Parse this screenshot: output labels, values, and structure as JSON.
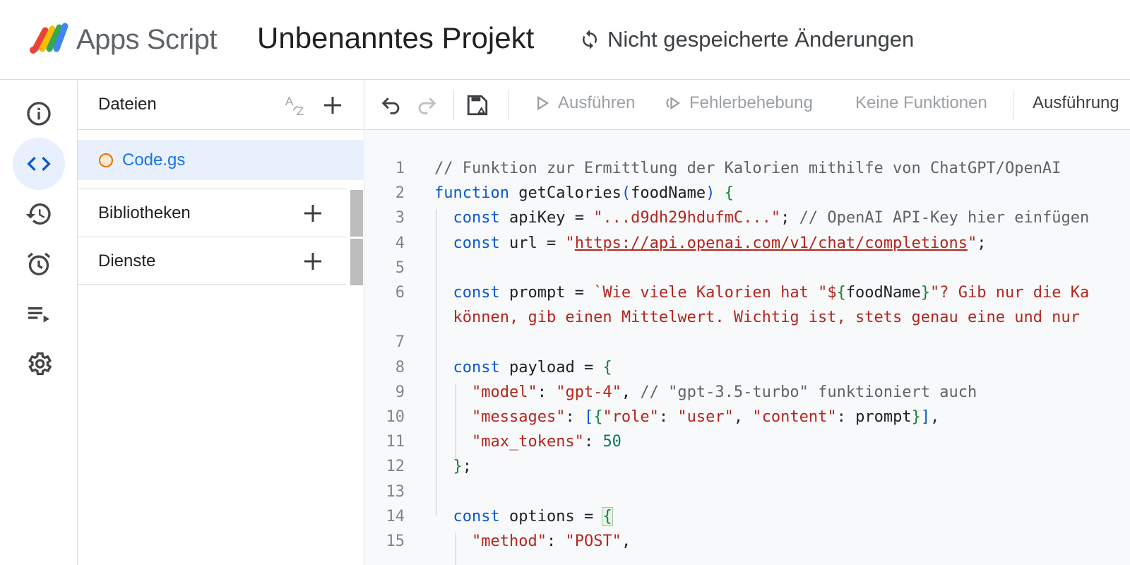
{
  "header": {
    "product_name": "Apps Script",
    "project_title": "Unbenanntes Projekt",
    "save_status": "Nicht gespeicherte Änderungen"
  },
  "rail": {
    "items": [
      {
        "name": "overview",
        "icon": "info-icon",
        "active": false
      },
      {
        "name": "editor",
        "icon": "code-icon",
        "active": true
      },
      {
        "name": "executions",
        "icon": "history-icon",
        "active": false
      },
      {
        "name": "triggers",
        "icon": "alarm-icon",
        "active": false
      },
      {
        "name": "executions-log",
        "icon": "playlist-icon",
        "active": false
      },
      {
        "name": "settings",
        "icon": "gear-icon",
        "active": false
      }
    ]
  },
  "files_panel": {
    "title": "Dateien",
    "files": [
      {
        "name": "Code.gs"
      }
    ],
    "libraries_label": "Bibliotheken",
    "services_label": "Dienste"
  },
  "toolbar": {
    "run_label": "Ausführen",
    "debug_label": "Fehlerbehebung",
    "function_select": "Keine Funktionen",
    "execution_log_label": "Ausführung"
  },
  "code": {
    "lines": [
      {
        "n": "1",
        "text": "// Funktion zur Ermittlung der Kalorien mithilfe von ChatGPT/OpenAI"
      },
      {
        "n": "2",
        "text": "function getCalories(foodName) {"
      },
      {
        "n": "3",
        "text": "  const apiKey = \"...d9dh29hdufmC...\"; // OpenAI API-Key hier einfügen"
      },
      {
        "n": "4",
        "text": "  const url = \"https://api.openai.com/v1/chat/completions\";"
      },
      {
        "n": "5",
        "text": ""
      },
      {
        "n": "6",
        "text": "  const prompt = `Wie viele Kalorien hat \"${foodName}\"? Gib nur die Ka"
      },
      {
        "n": "",
        "text": "  können, gib einen Mittelwert. Wichtig ist, stets genau eine und nur"
      },
      {
        "n": "7",
        "text": ""
      },
      {
        "n": "8",
        "text": "  const payload = {"
      },
      {
        "n": "9",
        "text": "    \"model\": \"gpt-4\", // \"gpt-3.5-turbo\" funktioniert auch"
      },
      {
        "n": "10",
        "text": "    \"messages\": [{\"role\": \"user\", \"content\": prompt}],"
      },
      {
        "n": "11",
        "text": "    \"max_tokens\": 50"
      },
      {
        "n": "12",
        "text": "  };"
      },
      {
        "n": "13",
        "text": ""
      },
      {
        "n": "14",
        "text": "  const options = {"
      },
      {
        "n": "15",
        "text": "    \"method\": \"POST\","
      }
    ]
  },
  "colors": {
    "accent": "#1a73e8",
    "active_bg": "#e8f0fe",
    "keyword": "#0b57d0",
    "string": "#b3261e",
    "comment": "#5f6368",
    "number": "#00796b"
  }
}
